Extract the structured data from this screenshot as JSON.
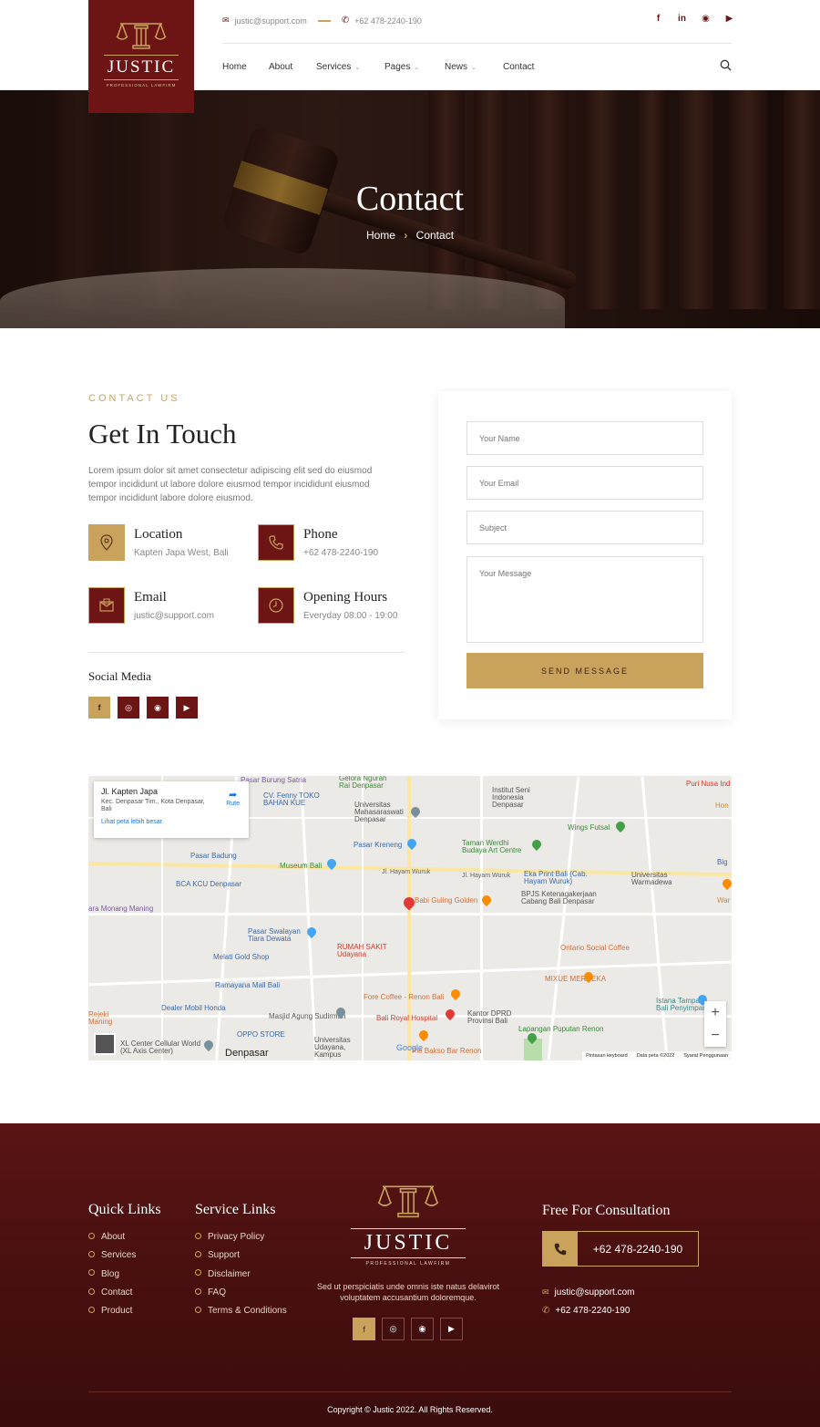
{
  "brand": {
    "name": "JUSTIC",
    "tagline": "PROFESSIONAL LAWFIRM"
  },
  "topbar": {
    "email": "justic@support.com",
    "phone": "+62 478-2240-190",
    "social": [
      {
        "icon": "facebook-icon",
        "glyph": "f"
      },
      {
        "icon": "linkedin-icon",
        "glyph": "in"
      },
      {
        "icon": "whatsapp-icon",
        "glyph": "◉"
      },
      {
        "icon": "youtube-icon",
        "glyph": "▶"
      }
    ]
  },
  "nav": {
    "items": [
      {
        "label": "Home",
        "dropdown": false
      },
      {
        "label": "About",
        "dropdown": false
      },
      {
        "label": "Services",
        "dropdown": true
      },
      {
        "label": "Pages",
        "dropdown": true
      },
      {
        "label": "News",
        "dropdown": true
      },
      {
        "label": "Contact",
        "dropdown": false
      }
    ]
  },
  "hero": {
    "title": "Contact",
    "breadcrumb": [
      "Home",
      "Contact"
    ]
  },
  "contact": {
    "eyebrow": "CONTACT US",
    "heading": "Get In Touch",
    "paragraph": "Lorem ipsum dolor sit amet consectetur adipiscing elit sed do eiusmod tempor incididunt ut labore dolore eiusmod tempor incididunt eiusmod tempor incididunt labore dolore eiusmod.",
    "info": [
      {
        "title": "Location",
        "value": "Kapten Japa West, Bali",
        "icon": "location-pin-icon"
      },
      {
        "title": "Phone",
        "value": "+62 478-2240-190",
        "icon": "phone-icon"
      },
      {
        "title": "Email",
        "value": "justic@support.com",
        "icon": "envelope-icon"
      },
      {
        "title": "Opening Hours",
        "value": "Everyday 08:00 - 19:00",
        "icon": "clock-icon"
      }
    ],
    "social_title": "Social Media"
  },
  "form": {
    "name_placeholder": "Your Name",
    "email_placeholder": "Your Email",
    "subject_placeholder": "Subject",
    "message_placeholder": "Your Message",
    "submit": "SEND MESSAGE"
  },
  "map": {
    "place_name": "Jl. Kapten Japa",
    "place_address": "Kec. Denpasar Tim., Kota Denpasar, Bali",
    "route_label": "Rute",
    "larger_map": "Lihat peta lebih besar",
    "footer_texts": [
      "Pintasan keyboard",
      "Data peta ©2022",
      "Syarat Penggunaan"
    ],
    "google": "Google",
    "city_label": "Denpasar",
    "pois": [
      "Pasar Burung Satria",
      "Gelora Ngurah Rai Denpasar",
      "Institut Seni Indonesia Denpasar",
      "Puri Nusa Ind",
      "CV. Fenny TOKO BAHAN KUE",
      "Universitas Mahasaraswati Denpasar",
      "Wings Futsal",
      "Hon",
      "Pasar Kreneng",
      "Taman Werdhi Budaya Art Centre",
      "Pasar Badung",
      "Museum Bali",
      "Big",
      "Jl. Hayam Wuruk",
      "Jl. Hayam Wuruk",
      "Eka Print Bali (Cab. Hayam Wuruk)",
      "Universitas Warmadewa",
      "BCA KCU Denpasar",
      "BPJS Ketenagakerjaan Cabang Bali Denpasar",
      "War",
      "ara Monang Maning",
      "Babi Guling Golden",
      "Pasar Swalayan Tiara Dewata",
      "RUMAH SAKIT Udayana",
      "Ontario Social Coffee",
      "Melati Gold Shop",
      "MIXUE MERDEKA",
      "Ramayana Mall Bali",
      "Fore Coffee - Renon Bali",
      "Dealer Mobil Honda",
      "Istana Tampak Bali Penyimpanan",
      "Rejeki Maning",
      "Masjid Agung Sudirman",
      "Bali Royal Hospital",
      "Kantor DPRD Provinsi Bali",
      "OPPO STORE",
      "Lapangan Puputan Renon",
      "XL Center Cellular World (XL Axis Center)",
      "Universitas Udayana, Kampus",
      "Pie Bakso Bar Renon"
    ]
  },
  "footer": {
    "quick_links_title": "Quick Links",
    "quick_links": [
      "About",
      "Services",
      "Blog",
      "Contact",
      "Product"
    ],
    "service_links_title": "Service Links",
    "service_links": [
      "Privacy Policy",
      "Support",
      "Disclaimer",
      "FAQ",
      "Terms & Conditions"
    ],
    "about_text": "Sed ut perspiciatis unde omnis iste natus delavirot voluptatem accusantium doloremque.",
    "consult_title": "Free For Consultation",
    "consult_phone": "+62 478-2240-190",
    "email": "justic@support.com",
    "phone": "+62 478-2240-190",
    "copyright": "Copyright © Justic 2022. All Rights Reserved."
  },
  "colors": {
    "maroon": "#6d1414",
    "gold": "#c9a35b",
    "footer": "#4a1010"
  }
}
